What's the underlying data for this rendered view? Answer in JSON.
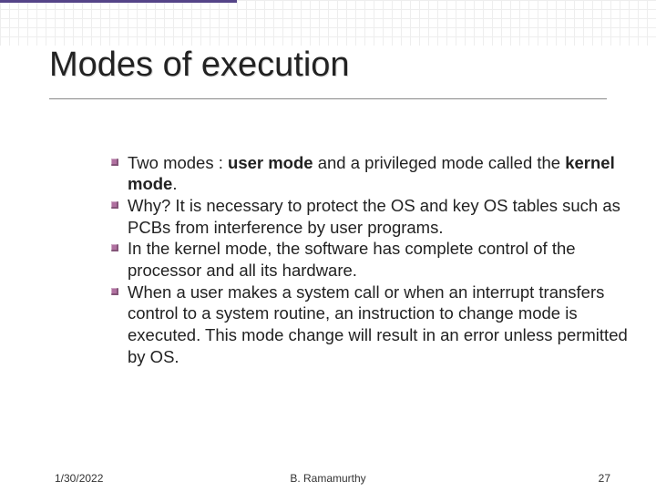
{
  "title": "Modes of execution",
  "bullets": {
    "b1_pre": "Two modes : ",
    "b1_bold1": "user mode",
    "b1_mid": " and a privileged mode called the ",
    "b1_bold2": "kernel mode",
    "b1_end": ".",
    "b2": "Why? It is necessary to protect the OS and key OS tables such as PCBs from interference by user programs.",
    "b3": "In the kernel mode, the software has complete control of the processor and all its hardware.",
    "b4": "When a user makes a system call or when an interrupt transfers control to a system routine, an instruction to change mode is executed. This mode change will result in an error unless permitted by OS."
  },
  "footer": {
    "date": "1/30/2022",
    "author": "B. Ramamurthy",
    "page": "27"
  }
}
